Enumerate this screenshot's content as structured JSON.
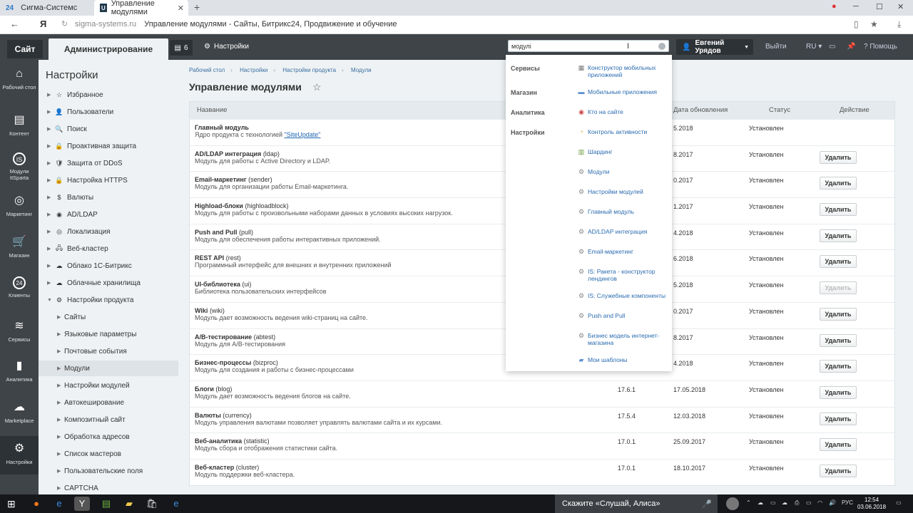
{
  "browser": {
    "tabs": [
      {
        "favicon": "24",
        "title": "Сигма-Системс"
      },
      {
        "favicon": "U",
        "title": "Управление модулями"
      }
    ],
    "new_tab": "+",
    "yandex": "Я",
    "domain": "sigma-systems.ru",
    "page_title": "Управление модулями - Сайты, Битрикс24, Продвижение и обучение"
  },
  "topbar": {
    "site": "Сайт",
    "admin": "Администрирование",
    "notif_count": "6",
    "settings": "Настройки",
    "user": "Евгений Урядов",
    "logout": "Выйти",
    "lang": "RU",
    "help": "Помощь"
  },
  "sidebar": [
    {
      "icon": "home-icon",
      "label": "Рабочий стол"
    },
    {
      "icon": "content-icon",
      "label": "Контент"
    },
    {
      "icon": "modules-itsparta-icon",
      "label": "Модули ItSparta"
    },
    {
      "icon": "marketing-icon",
      "label": "Маркетинг"
    },
    {
      "icon": "cart-icon",
      "label": "Магазин"
    },
    {
      "icon": "clients-icon",
      "label": "Клиенты"
    },
    {
      "icon": "services-icon",
      "label": "Сервисы"
    },
    {
      "icon": "analytics-icon",
      "label": "Аналитика"
    },
    {
      "icon": "marketplace-icon",
      "label": "Marketplace"
    },
    {
      "icon": "gear-icon",
      "label": "Настройки"
    }
  ],
  "menu": {
    "title": "Настройки",
    "items": [
      {
        "label": "Избранное",
        "sub": false
      },
      {
        "label": "Пользователи",
        "sub": false
      },
      {
        "label": "Поиск",
        "sub": false
      },
      {
        "label": "Проактивная защита",
        "sub": false
      },
      {
        "label": "Защита от DDoS",
        "sub": false
      },
      {
        "label": "Настройка HTTPS",
        "sub": false
      },
      {
        "label": "Валюты",
        "sub": false
      },
      {
        "label": "AD/LDAP",
        "sub": false
      },
      {
        "label": "Локализация",
        "sub": false
      },
      {
        "label": "Веб-кластер",
        "sub": false
      },
      {
        "label": "Облако 1С-Битрикс",
        "sub": false
      },
      {
        "label": "Облачные хранилища",
        "sub": false
      },
      {
        "label": "Настройки продукта",
        "sub": false
      },
      {
        "label": "Сайты",
        "sub": true
      },
      {
        "label": "Языковые параметры",
        "sub": true
      },
      {
        "label": "Почтовые события",
        "sub": true
      },
      {
        "label": "Модули",
        "sub": true
      },
      {
        "label": "Настройки модулей",
        "sub": true
      },
      {
        "label": "Автокеширование",
        "sub": true
      },
      {
        "label": "Композитный сайт",
        "sub": true
      },
      {
        "label": "Обработка адресов",
        "sub": true
      },
      {
        "label": "Список мастеров",
        "sub": true
      },
      {
        "label": "Пользовательские поля",
        "sub": true
      },
      {
        "label": "CAPTCHA",
        "sub": true
      }
    ]
  },
  "breadcrumbs": [
    "Рабочий стол",
    "Настройки",
    "Настройки продукта",
    "Модули"
  ],
  "page_title": "Управление модулями",
  "table": {
    "headers": {
      "name": "Название",
      "date": "Дата обновления",
      "status": "Статус",
      "action": "Действие"
    },
    "rows": [
      {
        "name": "Главный модуль",
        "code": "",
        "desc": "Ядро продукта с технологией ",
        "link": "\"SiteUpdate\"",
        "version": "",
        "date": "5.2018",
        "status": "Установлен",
        "button": ""
      },
      {
        "name": "AD/LDAP интеграция",
        "code": "(ldap)",
        "desc": "Модуль для работы с Active Directory и LDAP.",
        "link": "",
        "version": "",
        "date": "8.2017",
        "status": "Установлен",
        "button": "Удалить"
      },
      {
        "name": "Email-маркетинг",
        "code": "(sender)",
        "desc": "Модуль для организации работы Email-маркетинга.",
        "link": "",
        "version": "",
        "date": "0.2017",
        "status": "Установлен",
        "button": "Удалить"
      },
      {
        "name": "Highload-блоки",
        "code": "(highloadblock)",
        "desc": "Модуль для работы с произвольными наборами данных в условиях высоких нагрузок.",
        "link": "",
        "version": "",
        "date": "1.2017",
        "status": "Установлен",
        "button": "Удалить"
      },
      {
        "name": "Push and Pull",
        "code": "(pull)",
        "desc": "Модуль для обеспечения работы интерактивных приложений.",
        "link": "",
        "version": "",
        "date": "4.2018",
        "status": "Установлен",
        "button": "Удалить"
      },
      {
        "name": "REST API",
        "code": "(rest)",
        "desc": "Программный интерфейс для внешних и внутренних приложений",
        "link": "",
        "version": "",
        "date": "6.2018",
        "status": "Установлен",
        "button": "Удалить"
      },
      {
        "name": "UI-библиотека",
        "code": "(ui)",
        "desc": "Библиотека пользовательских интерфейсов",
        "link": "",
        "version": "",
        "date": "5.2018",
        "status": "Установлен",
        "button": "Удалить",
        "disabled": true
      },
      {
        "name": "Wiki",
        "code": "(wiki)",
        "desc": "Модуль дает возможность ведения wiki-страниц на сайте.",
        "link": "",
        "version": "",
        "date": "0.2017",
        "status": "Установлен",
        "button": "Удалить"
      },
      {
        "name": "A/B-тестирование",
        "code": "(abtest)",
        "desc": "Модуль для A/B-тестирования",
        "link": "",
        "version": "",
        "date": "8.2017",
        "status": "Установлен",
        "button": "Удалить"
      },
      {
        "name": "Бизнес-процессы",
        "code": "(bizproc)",
        "desc": "Модуль для создания и работы с бизнес-процессами",
        "link": "",
        "version": "",
        "date": "4.2018",
        "status": "Установлен",
        "button": "Удалить"
      },
      {
        "name": "Блоги",
        "code": "(blog)",
        "desc": "Модуль дает возможность ведения блогов на сайте.",
        "link": "",
        "version": "17.6.1",
        "date": "17.05.2018",
        "status": "Установлен",
        "button": "Удалить"
      },
      {
        "name": "Валюты",
        "code": "(currency)",
        "desc": "Модуль управления валютами позволяет управлять валютами сайта и их курсами.",
        "link": "",
        "version": "17.5.4",
        "date": "12.03.2018",
        "status": "Установлен",
        "button": "Удалить"
      },
      {
        "name": "Веб-аналитика",
        "code": "(statistic)",
        "desc": "Модуль сбора и отображения статистики сайта.",
        "link": "",
        "version": "17.0.1",
        "date": "25.09.2017",
        "status": "Установлен",
        "button": "Удалить"
      },
      {
        "name": "Веб-кластер",
        "code": "(cluster)",
        "desc": "Модуль поддержки веб-кластера.",
        "link": "",
        "version": "17.0.1",
        "date": "18.10.2017",
        "status": "Установлен",
        "button": "Удалить"
      }
    ]
  },
  "search": {
    "value": "модулі",
    "categories": [
      "Сервисы",
      "Магазин",
      "Аналитика",
      "Настройки"
    ],
    "results": [
      {
        "icon": "builder-icon",
        "label": "Конструктор мобильных приложений"
      },
      {
        "icon": "folder-icon",
        "label": "Мобильные приложения"
      },
      {
        "icon": "eye-icon",
        "label": "Кто на сайте"
      },
      {
        "icon": "activity-icon",
        "label": "Контроль активности"
      },
      {
        "icon": "sharding-icon",
        "label": "Шардинг"
      },
      {
        "icon": "gear-icon",
        "label": "Модули"
      },
      {
        "icon": "gear-icon",
        "label": "Настройки модулей"
      },
      {
        "icon": "gear-icon",
        "label": "Главный модуль"
      },
      {
        "icon": "gear-icon",
        "label": "AD/LDAP интеграция"
      },
      {
        "icon": "gear-icon",
        "label": "Email-маркетинг"
      },
      {
        "icon": "gear-icon",
        "label": "IS: Ракета - конструктор лендингов"
      },
      {
        "icon": "gear-icon",
        "label": "IS: Служебные компоненты"
      },
      {
        "icon": "gear-icon",
        "label": "Push and Pull"
      },
      {
        "icon": "gear-icon",
        "label": "Бизнес модель интернет-магазина"
      },
      {
        "icon": "template-icon",
        "label": "Мои шаблоны"
      }
    ]
  },
  "taskbar": {
    "cortana": "Скажите «Слушай, Алиса»",
    "lang": "РУС",
    "time": "12:54",
    "date": "03.06.2018"
  }
}
